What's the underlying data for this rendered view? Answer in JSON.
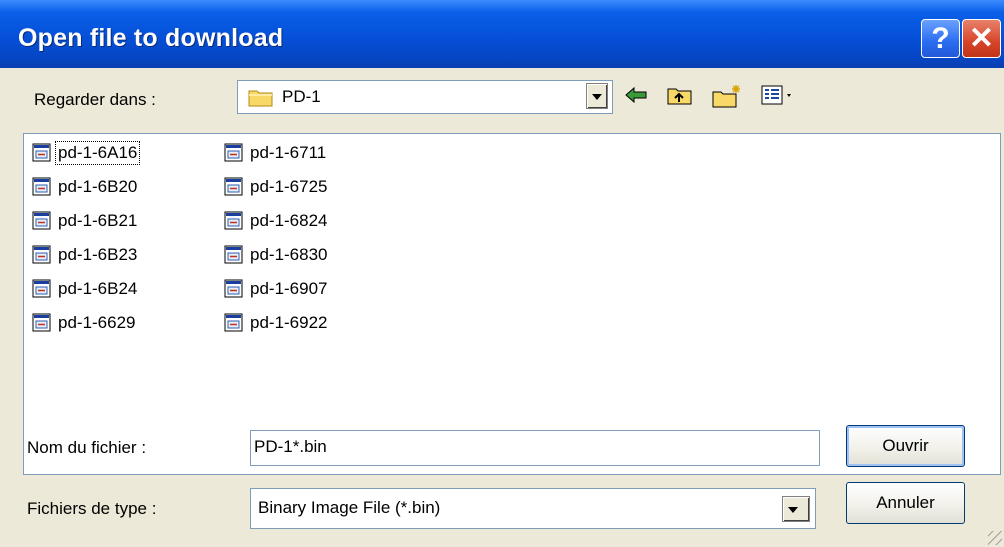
{
  "window": {
    "title": "Open file to download",
    "help_glyph": "?",
    "close_glyph": "✕"
  },
  "lookin": {
    "label": "Regarder dans :",
    "value": "PD-1"
  },
  "toolbar": {
    "icons": [
      "back-icon",
      "up-folder-icon",
      "new-folder-icon",
      "view-menu-icon"
    ]
  },
  "files": {
    "col1": [
      "pd-1-6A16",
      "pd-1-6B20",
      "pd-1-6B21",
      "pd-1-6B23",
      "pd-1-6B24",
      "pd-1-6629"
    ],
    "col2": [
      "pd-1-6711",
      "pd-1-6725",
      "pd-1-6824",
      "pd-1-6830",
      "pd-1-6907",
      "pd-1-6922"
    ]
  },
  "filename": {
    "label": "Nom du fichier :",
    "value": "PD-1*.bin"
  },
  "filetype": {
    "label": "Fichiers de type :",
    "value": "Binary Image File (*.bin)"
  },
  "buttons": {
    "open": "Ouvrir",
    "cancel": "Annuler"
  }
}
